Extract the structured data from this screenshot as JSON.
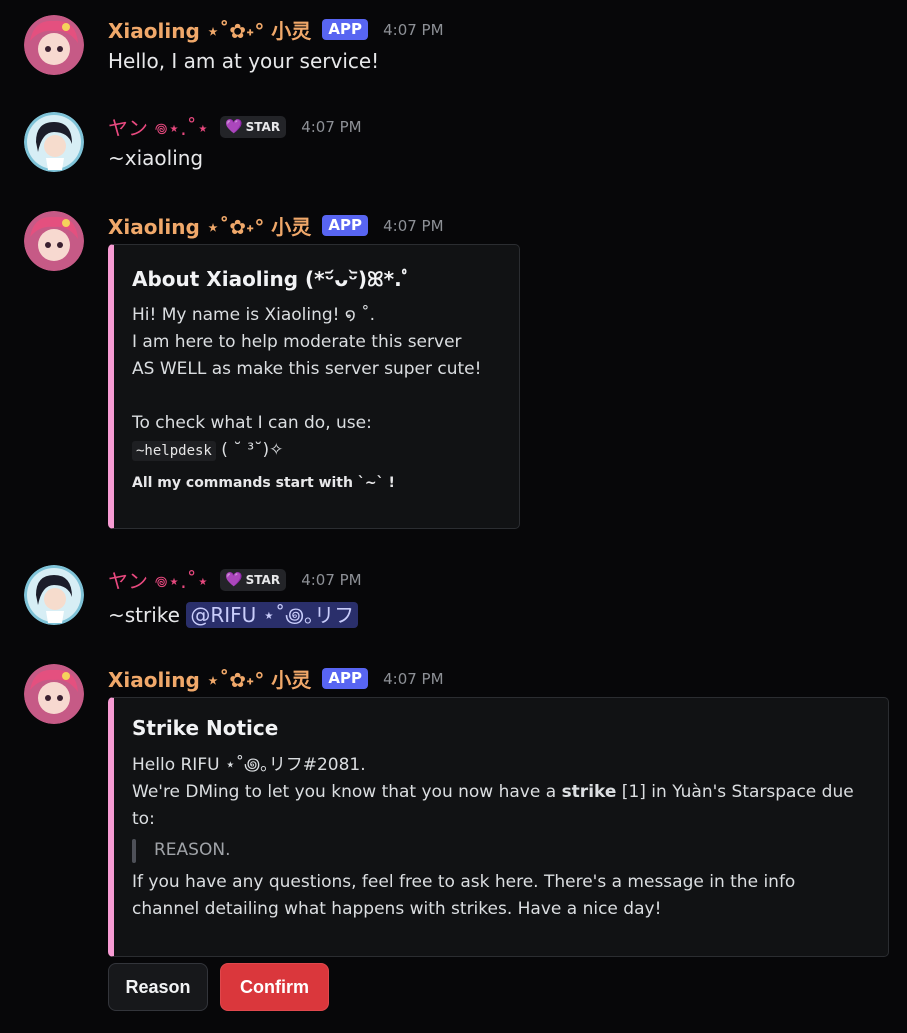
{
  "bot": {
    "name": "Xiaoling ⋆˚✿˖° 小灵",
    "badge": "APP"
  },
  "user": {
    "name": "ヤン 𖦹⋆.˚⋆",
    "badge_heart": "💜",
    "badge": "STAR"
  },
  "messages": [
    {
      "time": "4:07 PM",
      "text": "Hello, I am at your service!"
    },
    {
      "time": "4:07 PM",
      "text": "~xiaoling"
    },
    {
      "time": "4:07 PM",
      "embed": {
        "title": "About Xiaoling (*ᵕ᷄ᴗᵕ᷅)ꕤ*.ﾟ",
        "lines": [
          "Hi! My name is Xiaoling! ໑ ˚.",
          "I am here to help moderate this server",
          "AS WELL as make this server super cute!"
        ],
        "check_line": "To check what I can do, use:",
        "code": "~helpdesk",
        "code_suffix": " ( ˘ ³˘)✧",
        "footer": "All my commands start with `~` !"
      }
    },
    {
      "time": "4:07 PM",
      "text": "~strike ",
      "mention": "@RIFU ⋆˚꩜｡リフ"
    },
    {
      "time": "4:07 PM",
      "embed": {
        "title": "Strike Notice",
        "line1": "Hello RIFU ⋆˚꩜｡リフ#2081.",
        "line2_pre": "We're DMing to let you know that you now have a ",
        "line2_bold": "strike",
        "line2_post": " [1] in Yuàn's Starspace due",
        "line3": "to:",
        "quote": "REASON.",
        "line4": "If you have any questions, feel free to ask here. There's a message in the info",
        "line5": "channel detailing what happens with strikes. Have a nice day!"
      }
    }
  ],
  "buttons": {
    "reason": "Reason",
    "confirm": "Confirm"
  },
  "colors": {
    "bot_name": "#f0a86a",
    "user_name": "#e8497f",
    "app_badge": "#5865f2",
    "embed_accent": "#f79bd3",
    "danger": "#da373c"
  }
}
